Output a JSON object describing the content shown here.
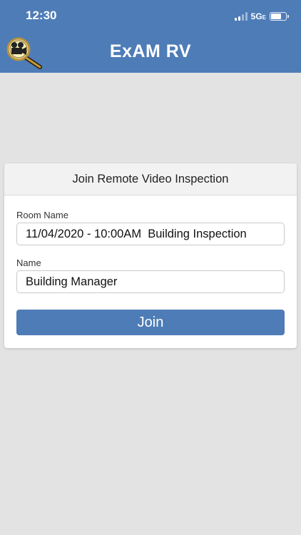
{
  "status_bar": {
    "time": "12:30",
    "network": "5G",
    "network_suffix": "E",
    "signal_bars_filled": 2,
    "signal_bars_total": 4,
    "battery_level": 0.7
  },
  "header": {
    "title": "ExAM RV",
    "logo_icon": "film-camera-magnifier-icon",
    "background_color": "#4e7cb7"
  },
  "form": {
    "title": "Join Remote Video Inspection",
    "room_name_label": "Room Name",
    "room_name_value": "11/04/2020 - 10:00AM  Building Inspection",
    "name_label": "Name",
    "name_value": "Building Manager",
    "join_label": "Join"
  },
  "colors": {
    "accent": "#4e7cb7",
    "page_background": "#e3e3e3"
  }
}
